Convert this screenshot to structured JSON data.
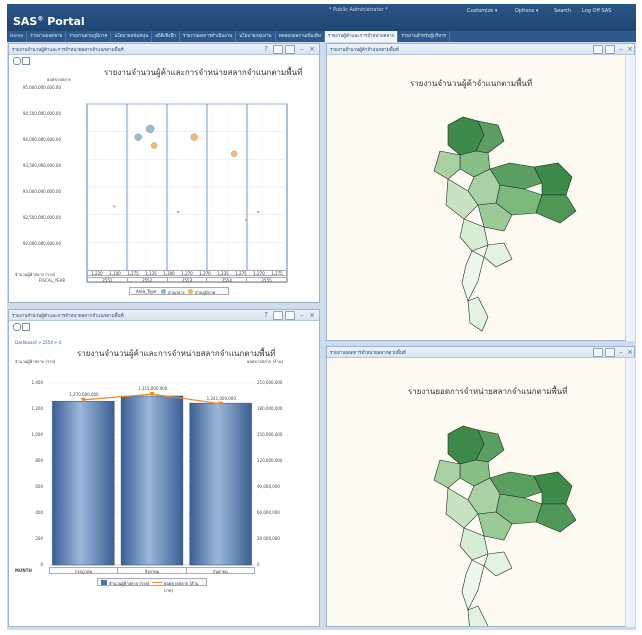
{
  "header": {
    "brand": "SAS",
    "brand_sup": "®",
    "brand_rest": " Portal",
    "user_text": "* Public Administrator *",
    "links": [
      "Customize ▾",
      "Options ▾",
      "Search",
      "Log Off SAS"
    ]
  },
  "nav": {
    "tabs": [
      "Home",
      "รายงานยอดขาย",
      "รายงานตามภูมิภาค",
      "นโยบายสนับสนุน",
      "สถิติเชิงลึก",
      "รายงานผลการดำเนินงาน",
      "นโยบายกลุ่มงาน",
      "ทดสอบผลงานเพิ่มเติม",
      "รายงานผู้ค้าและการจำหน่ายสลาก",
      "รายงานสำหรับผู้บริหาร"
    ],
    "active_index": 8
  },
  "panels": {
    "p1": {
      "title": "รายงานจำนวนผู้ค้าและการจำหน่ายสลากจำแนกตามพื้นที่"
    },
    "p2": {
      "title": "รายงานจำนวนผู้ค้าจำแนกตามพื้นที่"
    },
    "p3": {
      "title": "รายงานจำนวนผู้ค้าและการจำหน่ายสลากจำแนกตามพื้นที่"
    },
    "p4": {
      "title": "รายงานยอดการจำหน่ายสลากตามพื้นที่"
    }
  },
  "bubble_chart": {
    "title": "รายงานจำนวนผู้ค้าและการจำหน่ายสลากจำแนกตามพื้นที่",
    "ylabel": "ยอดขายสลาก",
    "yticks": [
      "95,000,000,000.00",
      "94,500,000,000.00",
      "94,000,000,000.00",
      "93,500,000,000.00",
      "93,000,000,000.00",
      "92,500,000,000.00",
      "92,000,000,000.00"
    ],
    "row1_label": "จำนวนผู้ค้าสลาก (ราย)",
    "row1": [
      "1,220",
      "1,100",
      "1,275",
      "1,135",
      "1,300",
      "1,270",
      "1,270",
      "1,235",
      "1,275",
      "1,270",
      "1,275"
    ],
    "row2_label": "FISCAL_YEAR",
    "row2": [
      "2551",
      "2552",
      "2553",
      "2554",
      "2555"
    ],
    "legend_label": "Area_Type",
    "legend": [
      {
        "name": "ส่วนกลาง",
        "color": "#8fb5c9"
      },
      {
        "name": "ส่วนภูมิภาค",
        "color": "#f2b55a"
      }
    ]
  },
  "map_panel_1": {
    "title": "รายงานจำนวนผู้ค้าจำแนกตามพื้นที่"
  },
  "bar_panel": {
    "breadcrumb": "Dashboard > 2554 > 4",
    "title": "รายงานจำนวนผู้ค้าและการจำหน่ายสลากจำแนกตามพื้นที่",
    "ylabel_left": "จำนวนผู้ค้าสลาก (ราย)",
    "ylabel_right": "ยอดขายสลาก (ล้าน)",
    "left_ticks": [
      "1,400",
      "1,200",
      "1,000",
      "800",
      "600",
      "400",
      "200",
      "0"
    ],
    "right_ticks": [
      "210,000,000",
      "180,000,000",
      "150,000,000",
      "120,000,000",
      "90,000,000",
      "60,000,000",
      "30,000,000",
      "0"
    ],
    "xaxis_title": "MONTH",
    "bar_labels": [
      "1,270,000,000",
      "1,315,000,000",
      "1,241,000,000"
    ],
    "legend": [
      {
        "name": "จำนวนผู้ค้าสลาก (ราย)",
        "color": "#4f75a8"
      },
      {
        "name": "ยอดขายสลาก (ล้านบาท)",
        "color": "#f08a1c"
      }
    ]
  },
  "map_panel_2": {
    "title": "รายงานยอดการจำหน่ายสลากจำแนกตามพื้นที่"
  },
  "chart_data": [
    {
      "type": "scatter",
      "title": "รายงานจำนวนผู้ค้าและการจำหน่ายสลากจำแนกตามพื้นที่",
      "ylabel": "ยอดขายสลาก",
      "ylim": [
        92000000000,
        95000000000
      ],
      "series": [
        {
          "name": "ส่วนกลาง",
          "color": "#8fb5c9",
          "points": [
            {
              "group": "2552",
              "y": 94400000000,
              "size": 3.5
            },
            {
              "group": "2552",
              "y": 94550000000,
              "size": 4
            },
            {
              "group": "2553",
              "y": 93050000000,
              "size": 1
            },
            {
              "group": "2555",
              "y": 93050000000,
              "size": 1
            }
          ]
        },
        {
          "name": "ส่วนภูมิภาค",
          "color": "#f2b55a",
          "points": [
            {
              "group": "2551",
              "y": 93150000000,
              "size": 1
            },
            {
              "group": "2552",
              "y": 94250000000,
              "size": 3
            },
            {
              "group": "2553",
              "y": 94400000000,
              "size": 3.5
            },
            {
              "group": "2554",
              "y": 94100000000,
              "size": 3
            },
            {
              "group": "2554",
              "y": 92900000000,
              "size": 1
            }
          ]
        }
      ]
    },
    {
      "type": "bar",
      "title": "รายงานจำนวนผู้ค้าและการจำหน่ายสลากจำแนกตามพื้นที่",
      "xlabel": "MONTH",
      "categories": [
        "กรกฎาคม",
        "สิงหาคม",
        "กันยายน"
      ],
      "ylim": [
        0,
        1400
      ],
      "series": [
        {
          "name": "จำนวนผู้ค้าสลาก (ราย)",
          "type": "bar",
          "values": [
            1260,
            1300,
            1245
          ]
        },
        {
          "name": "ยอดขายสลาก (ล้านบาท)",
          "type": "line",
          "axis": "right",
          "ylim": [
            0,
            210000000
          ],
          "values": [
            190500000,
            197250000,
            186150000
          ]
        }
      ]
    }
  ]
}
